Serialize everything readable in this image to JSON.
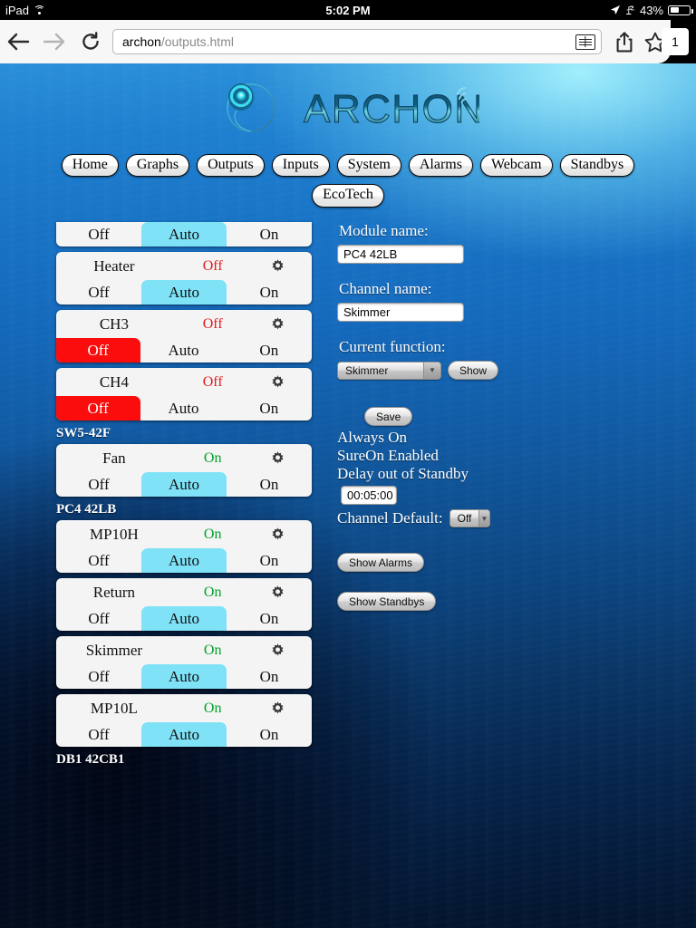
{
  "status_bar": {
    "device": "iPad",
    "wifi_icon": "wifi-icon",
    "time": "5:02 PM",
    "location_icon": "location-arrow-icon",
    "bluetooth_icon": "bluetooth-icon",
    "battery_percent": "43%",
    "battery_icon": "battery-icon"
  },
  "browser": {
    "back_icon": "back-arrow-icon",
    "forward_icon": "forward-arrow-icon",
    "reload_icon": "reload-icon",
    "url_host": "archon",
    "url_path": "/outputs.html",
    "reader_icon": "reader-view-icon",
    "share_icon": "share-icon",
    "bookmark_icon": "bookmark-star-icon",
    "tab_count": "1"
  },
  "logo": {
    "wordmark": "ARCHON",
    "mark_icon": "archon-swirl-icon",
    "signal_icon": "signal-waves-icon"
  },
  "nav": {
    "row1": [
      {
        "label": "Home"
      },
      {
        "label": "Graphs"
      },
      {
        "label": "Outputs"
      },
      {
        "label": "Inputs"
      },
      {
        "label": "System"
      },
      {
        "label": "Alarms"
      },
      {
        "label": "Webcam"
      },
      {
        "label": "Standbys"
      }
    ],
    "row2": [
      {
        "label": "EcoTech"
      }
    ]
  },
  "outputs": {
    "button_labels": {
      "off": "Off",
      "auto": "Auto",
      "on": "On"
    },
    "gear_icon": "gear-icon",
    "groups": [
      {
        "header": "",
        "header_visible": false,
        "channels": [
          {
            "name": "",
            "title_visible": false,
            "state": "",
            "selected": "auto",
            "clipped_top": true
          },
          {
            "name": "Heater",
            "title_visible": true,
            "state": "Off",
            "state_kind": "off",
            "selected": "auto",
            "clipped_top": false
          },
          {
            "name": "CH3",
            "title_visible": true,
            "state": "Off",
            "state_kind": "off",
            "selected": "off",
            "clipped_top": false
          },
          {
            "name": "CH4",
            "title_visible": true,
            "state": "Off",
            "state_kind": "off",
            "selected": "off",
            "clipped_top": false
          }
        ]
      },
      {
        "header": "SW5-42F",
        "header_visible": true,
        "channels": [
          {
            "name": "Fan",
            "title_visible": true,
            "state": "On",
            "state_kind": "on",
            "selected": "auto",
            "clipped_top": false
          }
        ]
      },
      {
        "header": "PC4 42LB",
        "header_visible": true,
        "channels": [
          {
            "name": "MP10H",
            "title_visible": true,
            "state": "On",
            "state_kind": "on",
            "selected": "auto",
            "clipped_top": false
          },
          {
            "name": "Return",
            "title_visible": true,
            "state": "On",
            "state_kind": "on",
            "selected": "auto",
            "clipped_top": false
          },
          {
            "name": "Skimmer",
            "title_visible": true,
            "state": "On",
            "state_kind": "on",
            "selected": "auto",
            "clipped_top": false
          },
          {
            "name": "MP10L",
            "title_visible": true,
            "state": "On",
            "state_kind": "on",
            "selected": "auto",
            "clipped_top": false
          }
        ]
      },
      {
        "header": "DB1 42CB1",
        "header_visible": true,
        "clipped_bottom": true,
        "channels": []
      }
    ]
  },
  "form": {
    "module_name_label": "Module name:",
    "module_name_value": "PC4 42LB",
    "channel_name_label": "Channel name:",
    "channel_name_value": "Skimmer",
    "current_function_label": "Current function:",
    "current_function_value": "Skimmer",
    "show_button": "Show",
    "save_button": "Save",
    "always_on": "Always On",
    "sureon_enabled": "SureOn Enabled",
    "delay_out_of_standby": "Delay out of Standby",
    "delay_value": "00:05:00",
    "channel_default_label": "Channel Default:",
    "channel_default_value": "Off",
    "show_alarms_button": "Show Alarms",
    "show_standbys_button": "Show Standbys",
    "dropdown_arrow_icon": "chevron-down-icon"
  },
  "colors": {
    "auto_selected": "#7fe2f7",
    "off_selected": "#fb0d0d",
    "state_on": "#00a32a",
    "state_off": "#e01b1b",
    "card_bg": "#f4f4f4"
  }
}
